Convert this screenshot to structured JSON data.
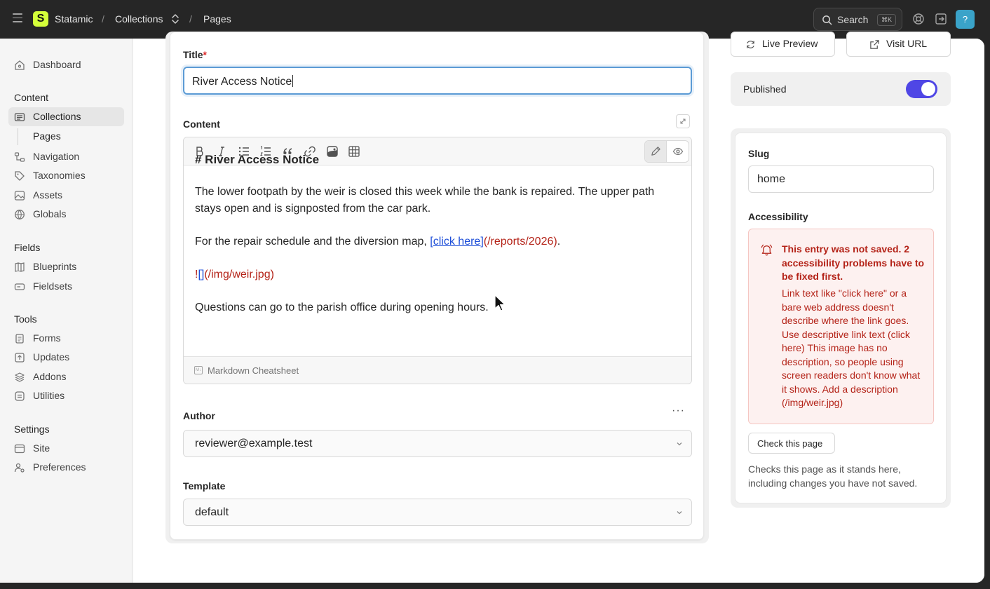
{
  "topbar": {
    "app_name": "Statamic",
    "logo_letter": "S",
    "breadcrumbs": [
      "Collections",
      "Pages"
    ],
    "separator": "/",
    "search_label": "Search",
    "search_shortcut": "⌘K",
    "help_label": "?"
  },
  "sidebar": {
    "dashboard": "Dashboard",
    "sections": [
      {
        "heading": "Content",
        "items": [
          "Collections",
          "Navigation",
          "Taxonomies",
          "Assets",
          "Globals"
        ]
      },
      {
        "heading": "Fields",
        "items": [
          "Blueprints",
          "Fieldsets"
        ]
      },
      {
        "heading": "Tools",
        "items": [
          "Forms",
          "Updates",
          "Addons",
          "Utilities"
        ]
      },
      {
        "heading": "Settings",
        "items": [
          "Site",
          "Preferences"
        ]
      }
    ],
    "sub_item": "Pages",
    "active_item": "Collections"
  },
  "entry": {
    "title_label": "Title",
    "required_mark": "*",
    "title_value": "River Access Notice",
    "content_label": "Content",
    "content": {
      "heading": "# River Access Notice",
      "para1": "The lower footpath by the weir is closed this week while the bank is repaired. The upper path stays open and is signposted from the car park.",
      "para2_prefix": "For the repair schedule and the diversion map, ",
      "para2_link": "[click here]",
      "para2_url": "(/reports/2026)",
      "para2_suffix": ".",
      "image_bang": "!",
      "image_brackets": "[]",
      "image_url": "(/img/weir.jpg)",
      "para3": "Questions can go to the parish office during opening hours."
    },
    "cheatsheet_label": "Markdown Cheatsheet",
    "cheatsheet_icon_text": "M↓",
    "author_label": "Author",
    "author_value": "reviewer@example.test",
    "more_label": "···",
    "template_label": "Template",
    "template_value": "default"
  },
  "side": {
    "live_preview": "Live Preview",
    "visit_url": "Visit URL",
    "published_label": "Published",
    "published": true,
    "slug_label": "Slug",
    "slug_value": "home",
    "accessibility_label": "Accessibility",
    "alert_heading": "This entry was not saved. 2 accessibility problems have to be fixed first.",
    "alert_body": "Link text like \"click here\" or a bare web address doesn't describe where the link goes. Use descriptive link text (click here) This image has no description, so people using screen readers don't know what it shows. Add a description (/img/weir.jpg)",
    "check_button": "Check this page",
    "check_note": "Checks this page as it stands here, including changes you have not saved."
  },
  "colors": {
    "accent": "#4f46e5",
    "error": "#b42318",
    "error_bg": "#fdf1f0",
    "focus_ring": "#5b9bd5",
    "logo": "#d4ff3a",
    "help": "#3aa3c9",
    "topbar": "#262626"
  }
}
